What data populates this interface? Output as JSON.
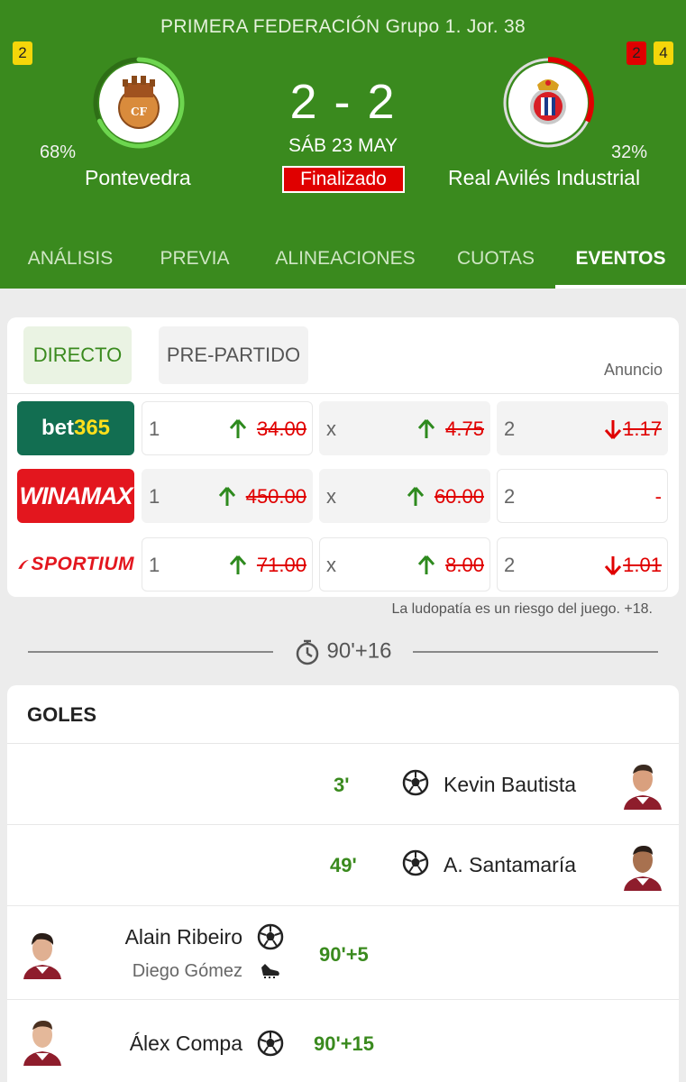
{
  "header": {
    "competition": "PRIMERA FEDERACIÓN Grupo 1.  Jor. 38",
    "score": "2 - 2",
    "date": "SÁB 23 MAY",
    "status": "Finalizado",
    "home": {
      "name": "Pontevedra",
      "possession": "68%",
      "possession_value": 0.68,
      "yellow_cards": "2",
      "color": "#6dd64f"
    },
    "away": {
      "name": "Real Avilés Industrial",
      "possession": "32%",
      "possession_value": 0.32,
      "red_cards": "2",
      "yellow_cards": "4",
      "color": "#e00000"
    }
  },
  "tabs": [
    {
      "label": "ANÁLISIS",
      "active": false
    },
    {
      "label": "PREVIA",
      "active": false
    },
    {
      "label": "ALINEACIONES",
      "active": false
    },
    {
      "label": "CUOTAS",
      "active": false
    },
    {
      "label": "EVENTOS",
      "active": true
    }
  ],
  "odds": {
    "segments": [
      "DIRECTO",
      "PRE-PARTIDO"
    ],
    "ad_label": "Anuncio",
    "bookmakers": [
      {
        "name": "bet365",
        "name_a": "bet",
        "name_b": "365",
        "home": {
          "label": "1",
          "value": "34.00",
          "trend": "up"
        },
        "draw": {
          "label": "x",
          "value": "4.75",
          "trend": "up"
        },
        "away": {
          "label": "2",
          "value": "1.17",
          "trend": "down"
        }
      },
      {
        "name": "WINAMAX",
        "home": {
          "label": "1",
          "value": "450.00",
          "trend": "up"
        },
        "draw": {
          "label": "x",
          "value": "60.00",
          "trend": "up"
        },
        "away": {
          "label": "2",
          "value": "-",
          "trend": "none"
        }
      },
      {
        "name": "SPORTIUM",
        "home": {
          "label": "1",
          "value": "71.00",
          "trend": "up"
        },
        "draw": {
          "label": "x",
          "value": "8.00",
          "trend": "up"
        },
        "away": {
          "label": "2",
          "value": "1.01",
          "trend": "down"
        }
      }
    ],
    "disclaimer": "La ludopatía es un riesgo del juego. +18."
  },
  "timeline": {
    "time": "90'+16"
  },
  "goals": {
    "title": "GOLES",
    "events": [
      {
        "side": "away",
        "minute": "3'",
        "player": "Kevin Bautista"
      },
      {
        "side": "away",
        "minute": "49'",
        "player": "A. Santamaría"
      },
      {
        "side": "home",
        "minute": "90'+5",
        "player": "Alain Ribeiro",
        "assist": "Diego Gómez"
      },
      {
        "side": "home",
        "minute": "90'+15",
        "player": "Álex Compa"
      }
    ]
  },
  "colors": {
    "brand_green": "#3a8a1e",
    "up": "#2e8a1e",
    "down": "#e00000"
  }
}
